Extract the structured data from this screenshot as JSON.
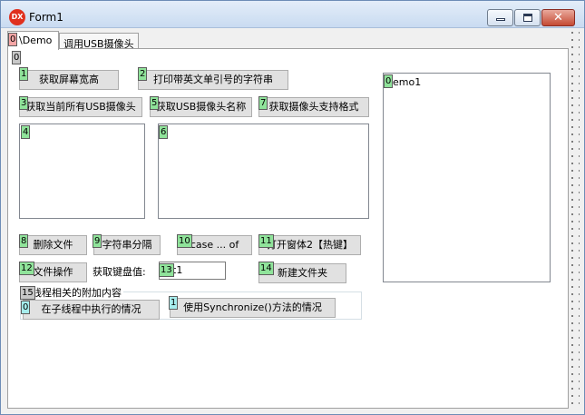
{
  "window": {
    "title": "Form1",
    "app_icon": "DX",
    "close_glyph": "✕"
  },
  "tabs": [
    {
      "label": "\\Demo",
      "badge": "0"
    },
    {
      "label": "调用USB摄像头"
    }
  ],
  "panel_badge": "0",
  "buttons": {
    "get_screen": {
      "label": "获取屏幕宽高",
      "badge": "1"
    },
    "print_string": {
      "label": "打印带英文单引号的字符串",
      "badge": "2"
    },
    "get_usb": {
      "label": "获取当前所有USB摄像头",
      "badge": "3"
    },
    "get_usb_name": {
      "label": "获取USB摄像头名称",
      "badge": "5"
    },
    "get_formats": {
      "label": "获取摄像头支持格式",
      "badge": "7"
    },
    "delete_file": {
      "label": "删除文件",
      "badge": "8"
    },
    "split_string": {
      "label": "字符串分隔",
      "badge": "9"
    },
    "case_of": {
      "label": "case ... of",
      "badge": "10"
    },
    "open_form2": {
      "label": "打开窗体2【热键】",
      "badge": "11"
    },
    "file_ops": {
      "label": "文件操作",
      "badge": "12"
    },
    "new_folder": {
      "label": "新建文件夹",
      "badge": "14"
    }
  },
  "memo1": {
    "badge": "4"
  },
  "memo2": {
    "badge": "6"
  },
  "memo3": {
    "badge": "0",
    "text": "emo1"
  },
  "keyboard": {
    "label": "获取键盘值:",
    "badge": "13",
    "value": "t1"
  },
  "group": {
    "badge": "15",
    "caption": "线程相关的附加内容",
    "btn_subthread": {
      "label": "在子线程中执行的情况",
      "badge": "0"
    },
    "btn_synchronize": {
      "label": "使用Synchronize()方法的情况",
      "badge": "1"
    }
  }
}
